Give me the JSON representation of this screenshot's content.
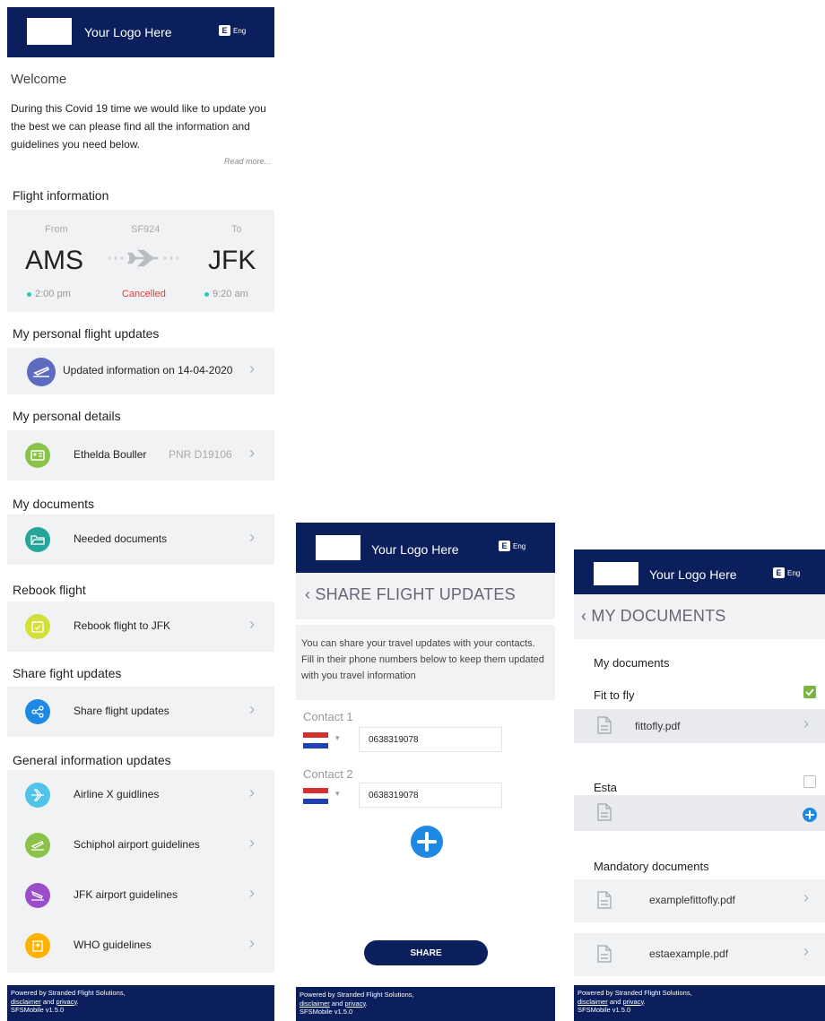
{
  "common": {
    "logo_text": "Your Logo Here",
    "lang_code": "E",
    "lang_label": "Eng",
    "footer_line1": "Powered by Stranded Flight Solutions,",
    "footer_disclaimer": "disclaimer",
    "footer_and": " and ",
    "footer_privacy": "privacy",
    "footer_dot": ".",
    "footer_version": "SFSMobile v1.5.0"
  },
  "home": {
    "welcome_title": "Welcome",
    "welcome_text": "During this Covid 19 time we would like to update you the best we can please find all the information and guidelines you need below.",
    "read_more": "Read more...",
    "flight_section": "Flight information",
    "flight": {
      "from_label": "From",
      "flight_no": "SF924",
      "to_label": "To",
      "from_code": "AMS",
      "to_code": "JFK",
      "dep_time": "2:00 pm",
      "status": "Cancelled",
      "arr_time": "9:20 am",
      "dot_color": "#2ec4b6",
      "status_color": "#e53935"
    },
    "updates_section": "My personal flight updates",
    "updates_label": "Updated information on 14-04-2020",
    "details_section": "My personal details",
    "details_name": "Ethelda Bouller",
    "details_pnr": "PNR D19106",
    "docs_section": "My documents",
    "docs_label": "Needed documents",
    "rebook_section": "Rebook flight",
    "rebook_label": "Rebook flight to JFK",
    "share_section": "Share fight updates",
    "share_label": "Share flight updates",
    "general_section": "General information updates",
    "general_items": [
      {
        "label": "Airline X guidlines",
        "color": "#4fc3e8",
        "icon": "airplane-icon"
      },
      {
        "label": "Schiphol airport guidelines",
        "color": "#8bc34a",
        "icon": "takeoff-icon"
      },
      {
        "label": "JFK airport guidelines",
        "color": "#9c4dcc",
        "icon": "landing-icon"
      },
      {
        "label": "WHO guidelines",
        "color": "#ffb300",
        "icon": "hospital-icon"
      }
    ]
  },
  "share": {
    "title": "SHARE FLIGHT UPDATES",
    "intro": "You can share your travel updates with your contacts. Fill in their phone numbers below to keep them updated with you travel information",
    "contacts": [
      {
        "label": "Contact 1",
        "phone": "0638319078"
      },
      {
        "label": "Contact 2",
        "phone": "0638319078"
      }
    ],
    "share_button": "SHARE",
    "accent": "#1e88e5"
  },
  "documents": {
    "title": "MY DOCUMENTS",
    "my_docs_section": "My documents",
    "fit_to_fly_label": "Fit to fly",
    "fit_to_fly_file": "fittofly.pdf",
    "fit_to_fly_checked": true,
    "esta_label": "Esta",
    "esta_checked": false,
    "mandatory_section": "Mandatory documents",
    "mandatory_files": [
      "examplefittofly.pdf",
      "estaexample.pdf"
    ],
    "check_color": "#7cb342"
  }
}
